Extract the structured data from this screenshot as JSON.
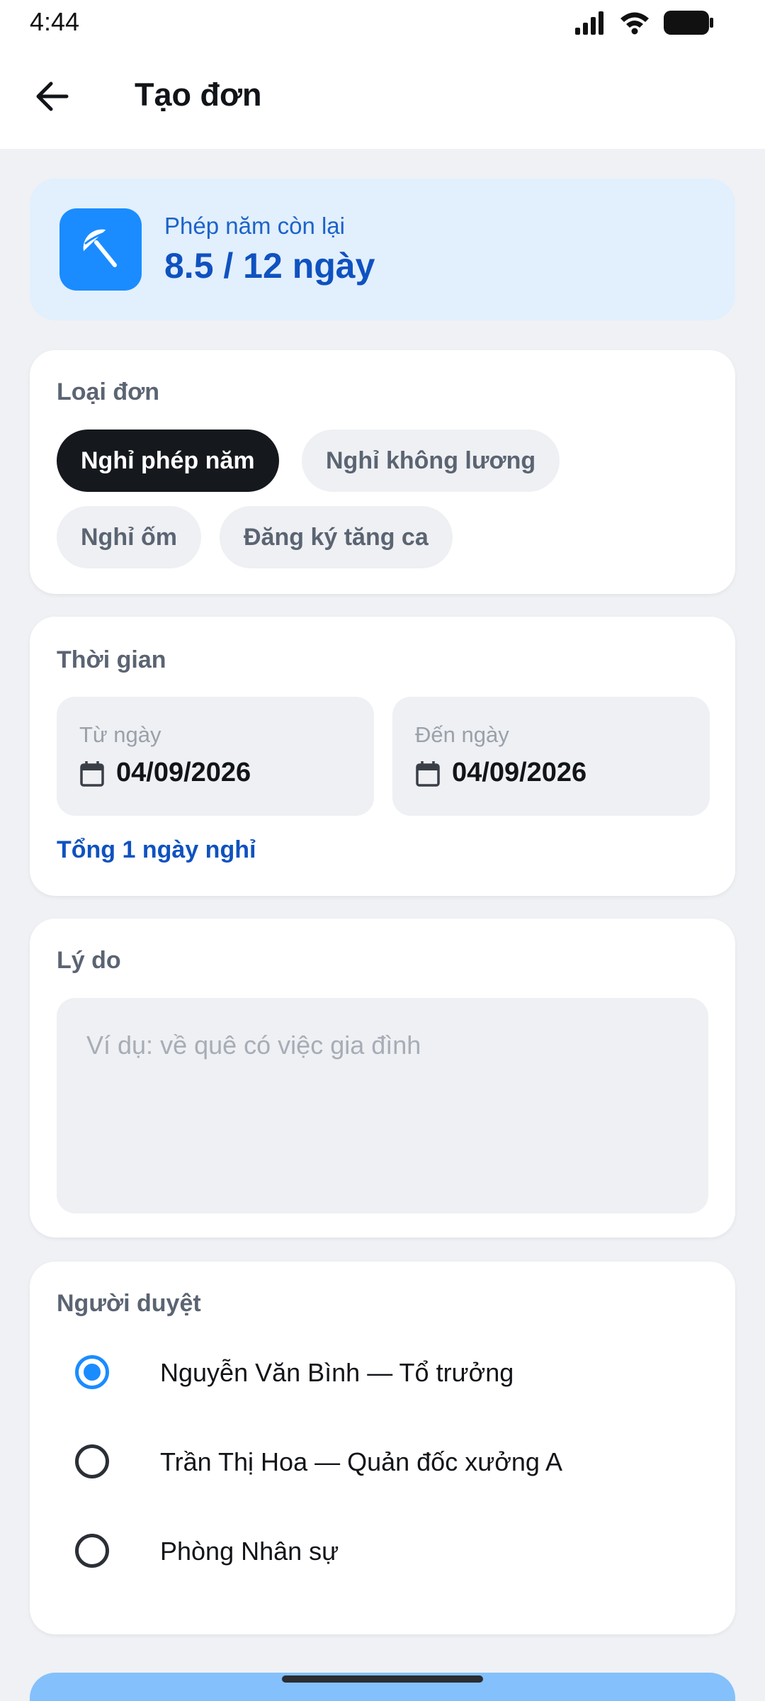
{
  "status_bar": {
    "time": "4:44"
  },
  "app_bar": {
    "title": "Tạo đơn",
    "back_icon": "arrow-left-icon"
  },
  "balance": {
    "label": "Phép năm còn lại",
    "value": "8.5 / 12 ngày",
    "icon": "umbrella-icon",
    "accent": "#1a8cff"
  },
  "leave_type": {
    "title": "Loại đơn",
    "options": [
      "Nghỉ phép năm",
      "Nghỉ không lương",
      "Nghỉ ốm",
      "Đăng ký tăng ca"
    ],
    "selected": "Nghỉ phép năm"
  },
  "time": {
    "title": "Thời gian",
    "from_label": "Từ ngày",
    "from_value": "04/09/2026",
    "to_label": "Đến ngày",
    "to_value": "04/09/2026",
    "total": "Tổng 1 ngày nghỉ"
  },
  "reason": {
    "title": "Lý do",
    "placeholder": "Ví dụ: về quê có việc gia đình",
    "value": ""
  },
  "approver": {
    "title": "Người duyệt",
    "options": [
      "Nguyễn Văn Bình — Tổ trưởng",
      "Trần Thị Hoa — Quản đốc xưởng A",
      "Phòng Nhân sự"
    ],
    "selected_index": 0
  },
  "colors": {
    "primary": "#1a8cff",
    "primary_dark": "#0f52c0",
    "chip_selected": "#15181d",
    "background": "#eff1f5"
  }
}
